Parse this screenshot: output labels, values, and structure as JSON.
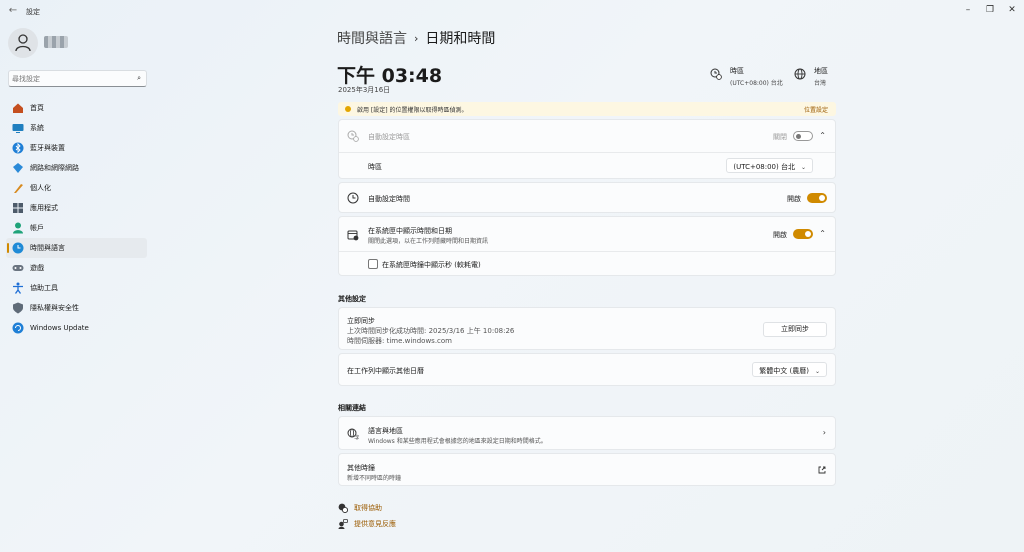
{
  "window": {
    "title": "設定",
    "back_glyph": "←",
    "min_glyph": "–",
    "max_glyph": "❐",
    "close_glyph": "✕"
  },
  "sidebar": {
    "search": {
      "placeholder": "尋找設定",
      "value": ""
    },
    "items": [
      {
        "label": "首頁",
        "icon": "home-icon",
        "color": "#c44f1f"
      },
      {
        "label": "系統",
        "icon": "system-icon",
        "color": "#1f7fbf"
      },
      {
        "label": "藍牙與裝置",
        "icon": "bluetooth-icon",
        "color": "#1f7fd6"
      },
      {
        "label": "網路和網際網路",
        "icon": "network-icon",
        "color": "#2b8ad8"
      },
      {
        "label": "個人化",
        "icon": "personalization-icon",
        "color": "#d78a1f"
      },
      {
        "label": "應用程式",
        "icon": "apps-icon",
        "color": "#4d5b6a"
      },
      {
        "label": "帳戶",
        "icon": "accounts-icon",
        "color": "#1fa37a"
      },
      {
        "label": "時間與語言",
        "icon": "time-language-icon",
        "color": "#1f8ad6",
        "active": true
      },
      {
        "label": "遊戲",
        "icon": "gaming-icon",
        "color": "#6a7480"
      },
      {
        "label": "協助工具",
        "icon": "accessibility-icon",
        "color": "#1f6fd6"
      },
      {
        "label": "隱私權與安全性",
        "icon": "privacy-icon",
        "color": "#5f6b78"
      },
      {
        "label": "Windows Update",
        "icon": "windows-update-icon",
        "color": "#1f7fd6"
      }
    ]
  },
  "header": {
    "parent": "時間與語言",
    "separator": "›",
    "title": "日期和時間",
    "current_time": "下午 03:48",
    "current_date": "2025年3月16日",
    "timezone": {
      "title": "時區",
      "value": "(UTC+08:00) 台北"
    },
    "region": {
      "title": "地區",
      "value": "台灣"
    }
  },
  "notice": {
    "text": "啟用 [設定] 的位置權限以取得時區偵測。",
    "link": "位置設定",
    "color": "#e3a600"
  },
  "settings": {
    "auto_timezone": {
      "label": "自動設定時區",
      "toggle_label": "關閉",
      "state": "off"
    },
    "timezone_row": {
      "label": "時區",
      "value": "(UTC+08:00) 台北"
    },
    "auto_time": {
      "label": "自動設定時間",
      "toggle_label": "開啟",
      "state": "on"
    },
    "tray_time": {
      "label": "在系統匣中顯示時間和日期",
      "sub": "關閉此選項，以在工作列隱藏時間和日期資訊",
      "toggle_label": "開啟",
      "state": "on"
    },
    "seconds_checkbox": {
      "label": "在系統匣時鐘中顯示秒 (較耗電)",
      "checked": false
    }
  },
  "other": {
    "section_title": "其他設定",
    "sync": {
      "title": "立即同步",
      "last_sync": "上次時間同步化成功時間: 2025/3/16 上午 10:08:26",
      "server": "時間伺服器: time.windows.com",
      "button": "立即同步"
    },
    "calendar": {
      "label": "在工作列中顯示其他日曆",
      "value": "繁體中文 (農曆)"
    }
  },
  "related": {
    "section_title": "相關連結",
    "language_region": {
      "title": "語言與地區",
      "sub": "Windows 和某些應用程式會根據您的地區來設定日期和時間格式。"
    },
    "additional_clocks": {
      "title": "其他時鐘",
      "sub": "新增不同時區的時鐘"
    }
  },
  "footer": {
    "help": "取得協助",
    "feedback": "提供意見反應"
  },
  "accent": "#d08a00"
}
